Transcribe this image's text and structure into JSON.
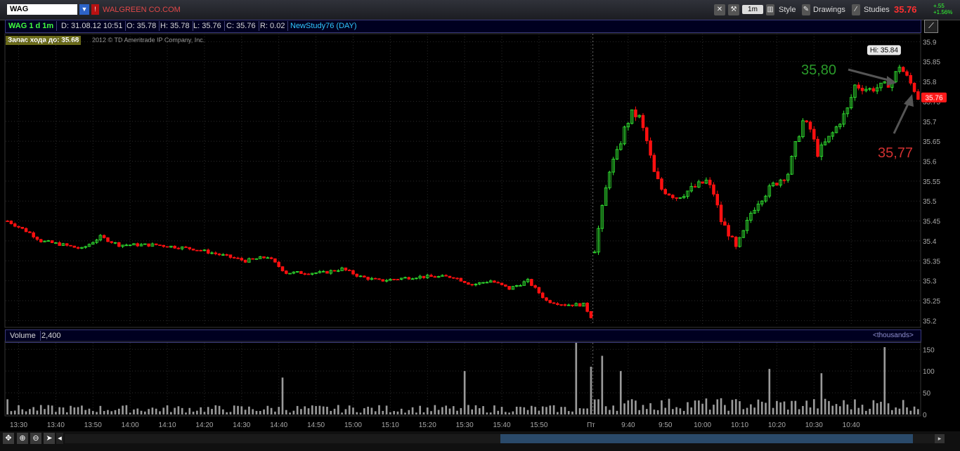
{
  "toolbar": {
    "symbol": "WAG",
    "company": "WALGREEN CO.COM",
    "timeframe": "1m",
    "style_label": "Style",
    "drawings_label": "Drawings",
    "studies_label": "Studies",
    "last_price": "35.76",
    "change_abs": "+.55",
    "change_pct": "+1.56%"
  },
  "info_bar": {
    "title": "WAG 1 d 1m",
    "date": "D: 31.08.12 10:51",
    "open": "O: 35.78",
    "high": "H: 35.78",
    "low": "L: 35.76",
    "close": "C: 35.76",
    "range": "R: 0.02",
    "study": "NewStudy76 (DAY)"
  },
  "reserve_label": "Запас хода до: 35.68",
  "copyright": "2012 © TD Ameritrade IP Company, Inc.",
  "volume_bar": {
    "label": "Volume",
    "value": "2,400",
    "units": "<thousands>"
  },
  "colors": {
    "up": "#33ee33",
    "down": "#ff1010",
    "grid": "#2a2a2a",
    "annot_up": "#2a9a2a",
    "annot_down": "#d03030"
  },
  "chart_data": {
    "type": "candlestick",
    "price_axis": {
      "ticks": [
        "35.9",
        "35.85",
        "35.8",
        "35.75",
        "35.7",
        "35.65",
        "35.6",
        "35.55",
        "35.5",
        "35.45",
        "35.4",
        "35.35",
        "35.3",
        "35.25",
        "35.2"
      ],
      "ylim": [
        35.19,
        35.92
      ]
    },
    "volume_axis": {
      "ticks": [
        "150",
        "100",
        "50",
        "0"
      ],
      "ylim": [
        0,
        165
      ]
    },
    "time_ticks": [
      "13:30",
      "13:40",
      "13:50",
      "14:00",
      "14:10",
      "14:20",
      "14:30",
      "14:40",
      "14:50",
      "15:00",
      "15:10",
      "15:20",
      "15:30",
      "15:40",
      "15:50",
      "Пт",
      "9:40",
      "9:50",
      "10:00",
      "10:10",
      "10:20",
      "10:30",
      "10:40"
    ],
    "price_path": [
      [
        0,
        35.45
      ],
      [
        6,
        35.42
      ],
      [
        9,
        35.4
      ],
      [
        15,
        35.39
      ],
      [
        20,
        35.38
      ],
      [
        25,
        35.41
      ],
      [
        30,
        35.39
      ],
      [
        40,
        35.39
      ],
      [
        50,
        35.38
      ],
      [
        55,
        35.37
      ],
      [
        64,
        35.35
      ],
      [
        70,
        35.36
      ],
      [
        75,
        35.32
      ],
      [
        85,
        35.32
      ],
      [
        90,
        35.33
      ],
      [
        95,
        35.31
      ],
      [
        100,
        35.3
      ],
      [
        110,
        35.31
      ],
      [
        120,
        35.31
      ],
      [
        125,
        35.29
      ],
      [
        130,
        35.3
      ],
      [
        135,
        35.28
      ],
      [
        140,
        35.3
      ],
      [
        145,
        35.25
      ],
      [
        150,
        35.24
      ],
      [
        155,
        35.24
      ],
      [
        157,
        35.21
      ],
      [
        158,
        35.38
      ],
      [
        160,
        35.48
      ],
      [
        162,
        35.58
      ],
      [
        164,
        35.62
      ],
      [
        166,
        35.68
      ],
      [
        168,
        35.72
      ],
      [
        170,
        35.71
      ],
      [
        172,
        35.65
      ],
      [
        174,
        35.57
      ],
      [
        176,
        35.53
      ],
      [
        180,
        35.51
      ],
      [
        184,
        35.53
      ],
      [
        188,
        35.55
      ],
      [
        190,
        35.52
      ],
      [
        192,
        35.45
      ],
      [
        194,
        35.42
      ],
      [
        196,
        35.38
      ],
      [
        198,
        35.42
      ],
      [
        200,
        35.47
      ],
      [
        202,
        35.5
      ],
      [
        206,
        35.54
      ],
      [
        210,
        35.57
      ],
      [
        212,
        35.64
      ],
      [
        214,
        35.7
      ],
      [
        216,
        35.68
      ],
      [
        218,
        35.62
      ],
      [
        222,
        35.67
      ],
      [
        226,
        35.73
      ],
      [
        228,
        35.79
      ],
      [
        232,
        35.78
      ],
      [
        236,
        35.79
      ],
      [
        238,
        35.8
      ],
      [
        240,
        35.84
      ],
      [
        242,
        35.81
      ],
      [
        244,
        35.78
      ],
      [
        245,
        35.76
      ]
    ],
    "volume_spikes": [
      [
        74,
        85
      ],
      [
        123,
        100
      ],
      [
        153,
        165
      ],
      [
        157,
        110
      ],
      [
        160,
        135
      ],
      [
        165,
        100
      ],
      [
        205,
        105
      ],
      [
        219,
        95
      ],
      [
        236,
        155
      ]
    ],
    "annotations": [
      {
        "label": "Hi: 35.84"
      },
      {
        "label": "35,80"
      },
      {
        "label": "35,77"
      }
    ]
  }
}
